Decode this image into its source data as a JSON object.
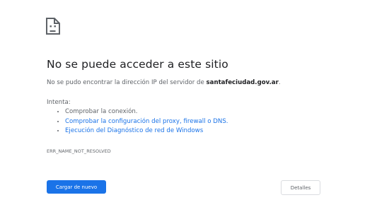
{
  "icon": "sad-document-icon",
  "title": "No se puede acceder a este sitio",
  "summary": {
    "prefix": "No se pudo encontrar la dirección IP del servidor de ",
    "host": "santafeciudad.gov.ar",
    "suffix": "."
  },
  "suggestions": {
    "heading": "Intenta:",
    "items": [
      {
        "label": "Comprobar la conexión."
      },
      {
        "label": "Comprobar la configuración del proxy, firewall o DNS."
      },
      {
        "label": "Ejecución del Diagnóstico de red de Windows"
      }
    ]
  },
  "error_code": "ERR_NAME_NOT_RESOLVED",
  "buttons": {
    "reload": "Cargar de nuevo",
    "details": "Detalles"
  },
  "colors": {
    "accent": "#1a73e8",
    "text": "#202124",
    "secondary": "#5f6368"
  }
}
